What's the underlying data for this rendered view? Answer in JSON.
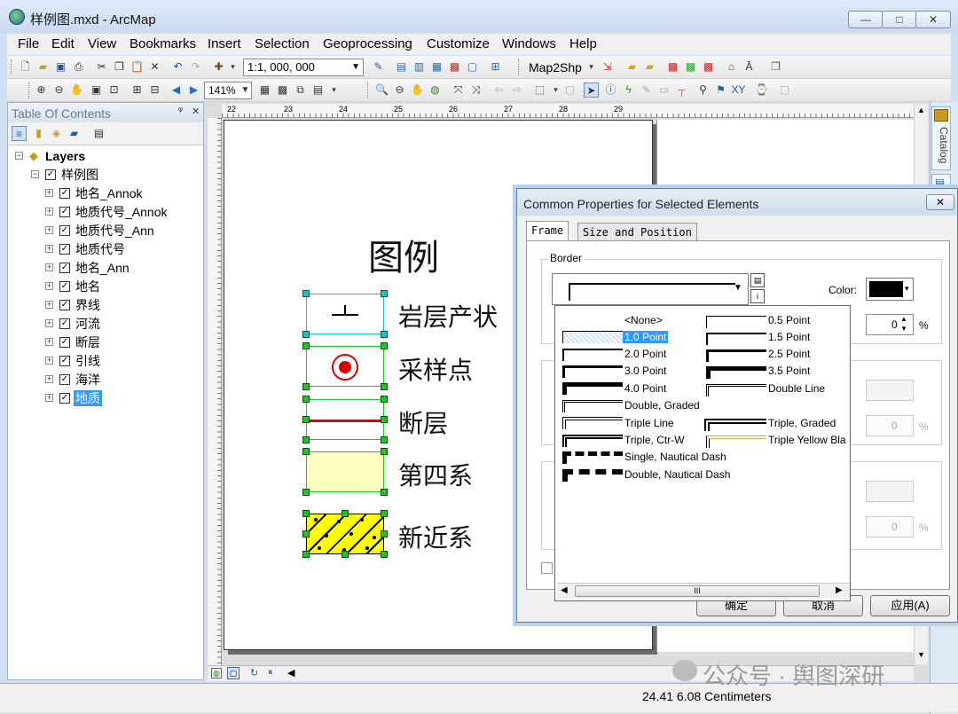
{
  "window": {
    "title": "样例图.mxd - ArcMap",
    "minimize": "—",
    "maximize": "□",
    "close": "✕"
  },
  "menu": [
    "File",
    "Edit",
    "View",
    "Bookmarks",
    "Insert",
    "Selection",
    "Geoprocessing",
    "Customize",
    "Windows",
    "Help"
  ],
  "toolbar": {
    "scale": "1:1, 000, 000",
    "map2shp": "Map2Shp",
    "zoom_level": "141%"
  },
  "toc": {
    "title": "Table Of Contents",
    "pin": "ᵠ",
    "close": "✕",
    "root": "Layers",
    "group": "样例图",
    "layers": [
      "地名_Annok",
      "地质代号_Annok",
      "地质代号_Ann",
      "地质代号",
      "地名_Ann",
      "地名",
      "界线",
      "河流",
      "断层",
      "引线",
      "海洋",
      "地质"
    ],
    "selected_layer": "地质"
  },
  "ruler": {
    "ticks": [
      "22",
      "23",
      "24",
      "25",
      "26",
      "27",
      "28",
      "29"
    ]
  },
  "legend": {
    "title": "图例",
    "items": [
      "岩层产状",
      "采样点",
      "断层",
      "第四系",
      "新近系"
    ]
  },
  "catalog_tab": "Catalog",
  "dialog": {
    "title": "Common Properties for Selected Elements",
    "close": "✕",
    "tabs": [
      "Frame",
      "Size and Position"
    ],
    "border_group": "Border",
    "color_label": "Color:",
    "gap_value": "0",
    "percent": "%",
    "disabled_values": [
      "0",
      "0"
    ],
    "buttons": [
      "确定",
      "取消",
      "应用(A)"
    ],
    "border_options_left": [
      "<None>",
      "1.0 Point",
      "2.0 Point",
      "3.0 Point",
      "4.0 Point",
      "Double, Graded",
      "Triple Line",
      "Triple, Ctr-W",
      "Single, Nautical Dash",
      "Double, Nautical Dash"
    ],
    "border_options_right": [
      "0.5 Point",
      "1.5 Point",
      "2.5 Point",
      "3.5 Point",
      "Double Line",
      "Triple, Graded",
      "Triple Yellow Bla"
    ],
    "selected_option": "1.0 Point",
    "scroll_grip": "III"
  },
  "status": {
    "coords": "24.41  6.08 Centimeters"
  },
  "watermark": "公众号 · 舆图深研",
  "colors": {
    "accent": "#3399ff",
    "handle_green": "#22c422",
    "fault_red": "#dd0000",
    "quaternary": "#ffffc0",
    "neogene": "#ffff00"
  }
}
